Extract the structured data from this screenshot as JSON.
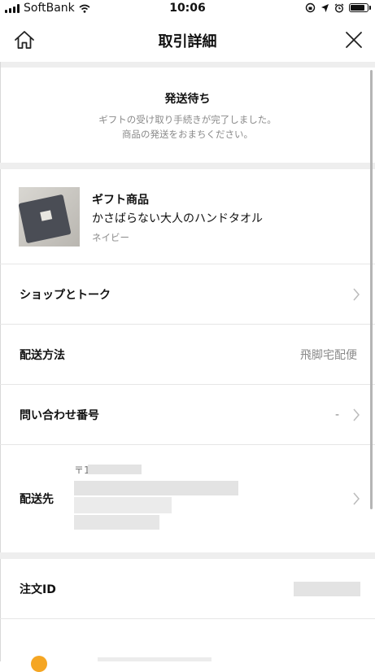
{
  "status_bar": {
    "carrier": "SoftBank",
    "time": "10:06",
    "battery_percent": 90
  },
  "header": {
    "title": "取引詳細",
    "home_icon": "home-icon",
    "close_icon": "close-icon"
  },
  "shipping_status": {
    "title": "発送待ち",
    "message_line1": "ギフトの受け取り手続きが完了しました。",
    "message_line2": "商品の発送をおまちください。"
  },
  "product": {
    "category": "ギフト商品",
    "name": "かさばらない大人のハンドタオル",
    "variant": "ネイビー"
  },
  "rows": {
    "shop_talk": {
      "label": "ショップとトーク"
    },
    "shipping_method": {
      "label": "配送方法",
      "value": "飛脚宅配便"
    },
    "inquiry_number": {
      "label": "問い合わせ番号",
      "value": "-"
    },
    "destination": {
      "label": "配送先",
      "postal_prefix": "〒1"
    },
    "order_id": {
      "label": "注文ID"
    }
  },
  "colors": {
    "muted_text": "#8a8a8a",
    "section_gap": "#eeeeee",
    "divider": "#e6e6e6"
  }
}
